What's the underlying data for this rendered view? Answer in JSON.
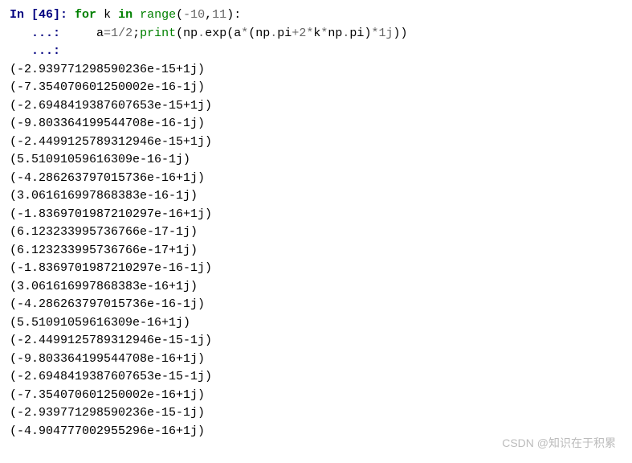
{
  "prompt": {
    "in_label": "In [",
    "number": "46",
    "close": "]: ",
    "continuation": "   ...: "
  },
  "code": {
    "kw_for": "for",
    "var_k": " k ",
    "kw_in": "in",
    "sp1": " ",
    "range_name": "range",
    "range_open": "(",
    "neg10": "-10",
    "comma1": ",",
    "eleven": "11",
    "range_close": ")",
    "colon": ":",
    "indent": "    ",
    "var_a": "a",
    "eq": "=",
    "one": "1",
    "slash": "/",
    "two": "2",
    "semi": ";",
    "print_name": "print",
    "p_open1": "(",
    "np1": "np",
    "dot1": ".",
    "exp": "exp",
    "p_open2": "(",
    "a2": "a",
    "star1": "*",
    "p_open3": "(",
    "np2": "np",
    "dot2": ".",
    "pi1": "pi",
    "plus": "+",
    "two2": "2",
    "star2": "*",
    "k2": "k",
    "star3": "*",
    "np3": "np",
    "dot3": ".",
    "pi2": "pi",
    "p_close3": ")",
    "star4": "*",
    "onej": "1j",
    "p_close2": ")",
    "p_close1": ")"
  },
  "outputs": [
    "(-2.939771298590236e-15+1j)",
    "(-7.354070601250002e-16-1j)",
    "(-2.6948419387607653e-15+1j)",
    "(-9.803364199544708e-16-1j)",
    "(-2.4499125789312946e-15+1j)",
    "(5.51091059616309e-16-1j)",
    "(-4.286263797015736e-16+1j)",
    "(3.061616997868383e-16-1j)",
    "(-1.8369701987210297e-16+1j)",
    "(6.123233995736766e-17-1j)",
    "(6.123233995736766e-17+1j)",
    "(-1.8369701987210297e-16-1j)",
    "(3.061616997868383e-16+1j)",
    "(-4.286263797015736e-16-1j)",
    "(5.51091059616309e-16+1j)",
    "(-2.4499125789312946e-15-1j)",
    "(-9.803364199544708e-16+1j)",
    "(-2.6948419387607653e-15-1j)",
    "(-7.354070601250002e-16+1j)",
    "(-2.939771298590236e-15-1j)",
    "(-4.904777002955296e-16+1j)"
  ],
  "watermark": "CSDN @知识在于积累"
}
